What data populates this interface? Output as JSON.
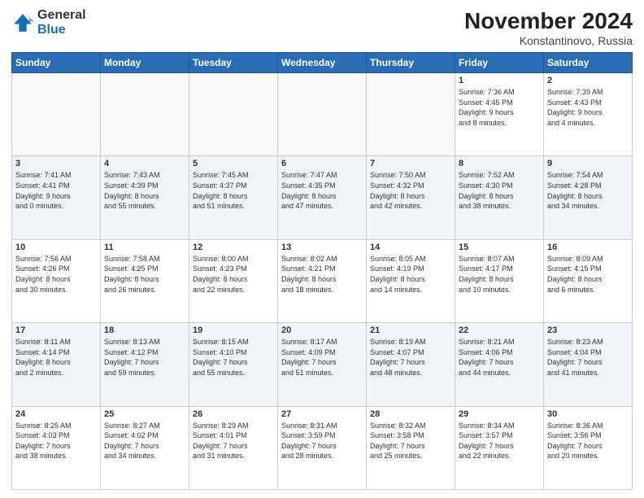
{
  "logo": {
    "general": "General",
    "blue": "Blue"
  },
  "header": {
    "title": "November 2024",
    "location": "Konstantinovo, Russia"
  },
  "weekdays": [
    "Sunday",
    "Monday",
    "Tuesday",
    "Wednesday",
    "Thursday",
    "Friday",
    "Saturday"
  ],
  "weeks": [
    [
      {
        "day": "",
        "info": ""
      },
      {
        "day": "",
        "info": ""
      },
      {
        "day": "",
        "info": ""
      },
      {
        "day": "",
        "info": ""
      },
      {
        "day": "",
        "info": ""
      },
      {
        "day": "1",
        "info": "Sunrise: 7:36 AM\nSunset: 4:45 PM\nDaylight: 9 hours\nand 8 minutes."
      },
      {
        "day": "2",
        "info": "Sunrise: 7:39 AM\nSunset: 4:43 PM\nDaylight: 9 hours\nand 4 minutes."
      }
    ],
    [
      {
        "day": "3",
        "info": "Sunrise: 7:41 AM\nSunset: 4:41 PM\nDaylight: 9 hours\nand 0 minutes."
      },
      {
        "day": "4",
        "info": "Sunrise: 7:43 AM\nSunset: 4:39 PM\nDaylight: 8 hours\nand 55 minutes."
      },
      {
        "day": "5",
        "info": "Sunrise: 7:45 AM\nSunset: 4:37 PM\nDaylight: 8 hours\nand 51 minutes."
      },
      {
        "day": "6",
        "info": "Sunrise: 7:47 AM\nSunset: 4:35 PM\nDaylight: 8 hours\nand 47 minutes."
      },
      {
        "day": "7",
        "info": "Sunrise: 7:50 AM\nSunset: 4:32 PM\nDaylight: 8 hours\nand 42 minutes."
      },
      {
        "day": "8",
        "info": "Sunrise: 7:52 AM\nSunset: 4:30 PM\nDaylight: 8 hours\nand 38 minutes."
      },
      {
        "day": "9",
        "info": "Sunrise: 7:54 AM\nSunset: 4:28 PM\nDaylight: 8 hours\nand 34 minutes."
      }
    ],
    [
      {
        "day": "10",
        "info": "Sunrise: 7:56 AM\nSunset: 4:26 PM\nDaylight: 8 hours\nand 30 minutes."
      },
      {
        "day": "11",
        "info": "Sunrise: 7:58 AM\nSunset: 4:25 PM\nDaylight: 8 hours\nand 26 minutes."
      },
      {
        "day": "12",
        "info": "Sunrise: 8:00 AM\nSunset: 4:23 PM\nDaylight: 8 hours\nand 22 minutes."
      },
      {
        "day": "13",
        "info": "Sunrise: 8:02 AM\nSunset: 4:21 PM\nDaylight: 8 hours\nand 18 minutes."
      },
      {
        "day": "14",
        "info": "Sunrise: 8:05 AM\nSunset: 4:19 PM\nDaylight: 8 hours\nand 14 minutes."
      },
      {
        "day": "15",
        "info": "Sunrise: 8:07 AM\nSunset: 4:17 PM\nDaylight: 8 hours\nand 10 minutes."
      },
      {
        "day": "16",
        "info": "Sunrise: 8:09 AM\nSunset: 4:15 PM\nDaylight: 8 hours\nand 6 minutes."
      }
    ],
    [
      {
        "day": "17",
        "info": "Sunrise: 8:11 AM\nSunset: 4:14 PM\nDaylight: 8 hours\nand 2 minutes."
      },
      {
        "day": "18",
        "info": "Sunrise: 8:13 AM\nSunset: 4:12 PM\nDaylight: 7 hours\nand 59 minutes."
      },
      {
        "day": "19",
        "info": "Sunrise: 8:15 AM\nSunset: 4:10 PM\nDaylight: 7 hours\nand 55 minutes."
      },
      {
        "day": "20",
        "info": "Sunrise: 8:17 AM\nSunset: 4:09 PM\nDaylight: 7 hours\nand 51 minutes."
      },
      {
        "day": "21",
        "info": "Sunrise: 8:19 AM\nSunset: 4:07 PM\nDaylight: 7 hours\nand 48 minutes."
      },
      {
        "day": "22",
        "info": "Sunrise: 8:21 AM\nSunset: 4:06 PM\nDaylight: 7 hours\nand 44 minutes."
      },
      {
        "day": "23",
        "info": "Sunrise: 8:23 AM\nSunset: 4:04 PM\nDaylight: 7 hours\nand 41 minutes."
      }
    ],
    [
      {
        "day": "24",
        "info": "Sunrise: 8:25 AM\nSunset: 4:03 PM\nDaylight: 7 hours\nand 38 minutes."
      },
      {
        "day": "25",
        "info": "Sunrise: 8:27 AM\nSunset: 4:02 PM\nDaylight: 7 hours\nand 34 minutes."
      },
      {
        "day": "26",
        "info": "Sunrise: 8:29 AM\nSunset: 4:01 PM\nDaylight: 7 hours\nand 31 minutes."
      },
      {
        "day": "27",
        "info": "Sunrise: 8:31 AM\nSunset: 3:59 PM\nDaylight: 7 hours\nand 28 minutes."
      },
      {
        "day": "28",
        "info": "Sunrise: 8:32 AM\nSunset: 3:58 PM\nDaylight: 7 hours\nand 25 minutes."
      },
      {
        "day": "29",
        "info": "Sunrise: 8:34 AM\nSunset: 3:57 PM\nDaylight: 7 hours\nand 22 minutes."
      },
      {
        "day": "30",
        "info": "Sunrise: 8:36 AM\nSunset: 3:56 PM\nDaylight: 7 hours\nand 20 minutes."
      }
    ]
  ]
}
